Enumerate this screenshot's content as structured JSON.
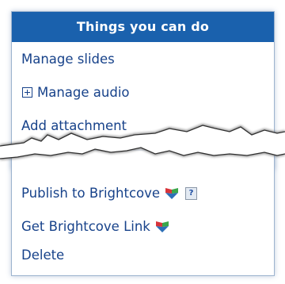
{
  "panel": {
    "title": "Things you can do"
  },
  "actions_top": [
    {
      "label": "Manage slides"
    },
    {
      "label": "Manage audio",
      "expandable": true
    },
    {
      "label": "Add attachment"
    }
  ],
  "actions_bottom": [
    {
      "label": "Publish to Brightcove",
      "icon": "brightcove-icon",
      "help": "?"
    },
    {
      "label": "Get Brightcove Link",
      "icon": "brightcove-icon"
    },
    {
      "label": "Delete"
    }
  ],
  "colors": {
    "header_bg": "#1a61ad",
    "link": "#17428a",
    "brightcove_red": "#d8343a",
    "brightcove_green": "#3aa64a",
    "brightcove_blue": "#2d6fb7"
  }
}
